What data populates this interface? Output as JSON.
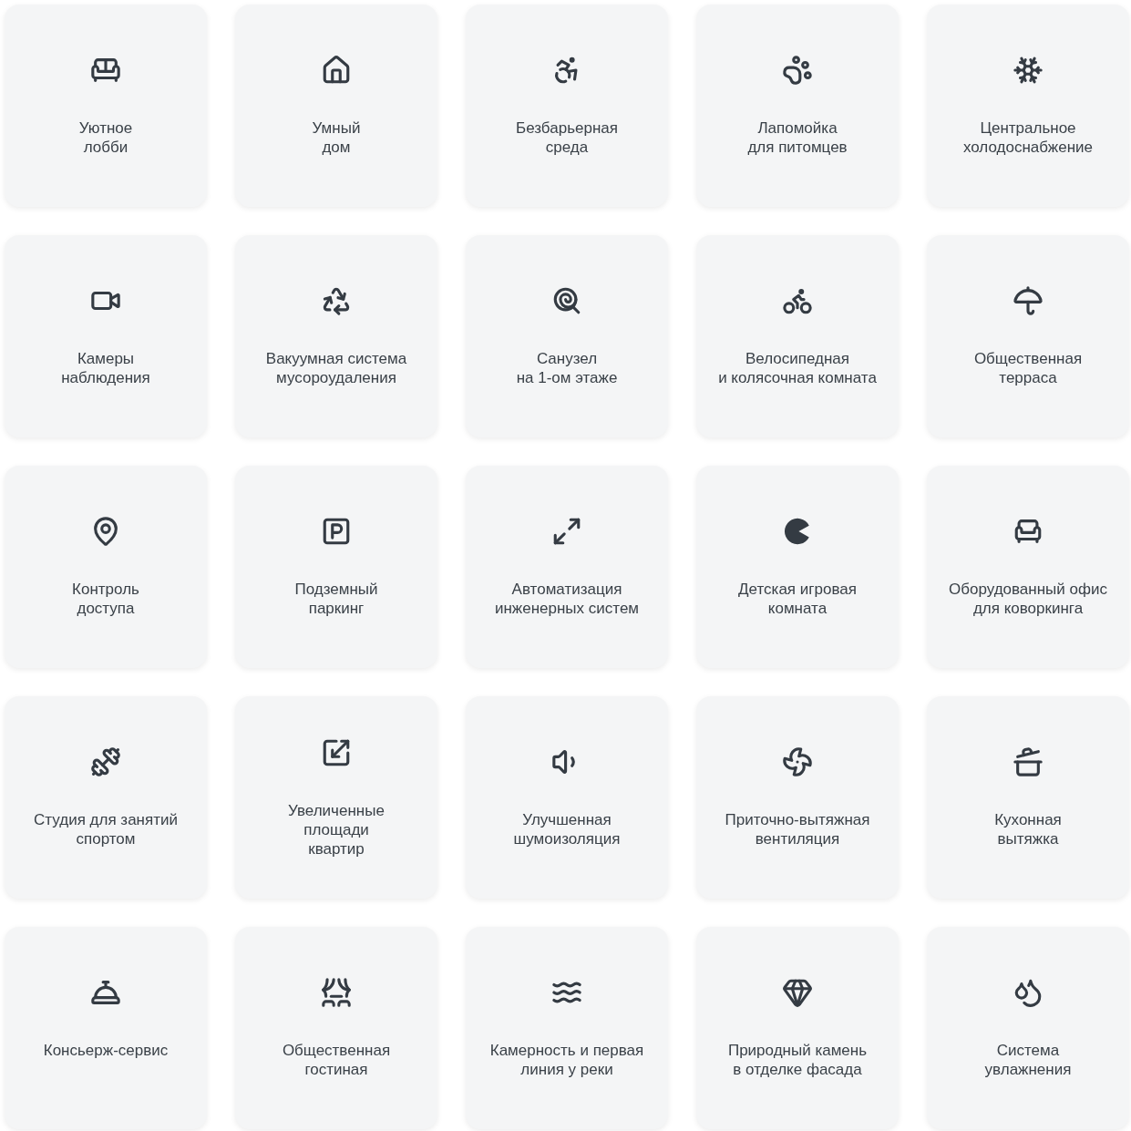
{
  "features": [
    {
      "label": "Уютное\nлобби"
    },
    {
      "label": "Умный\nдом"
    },
    {
      "label": "Безбарьерная\nсреда"
    },
    {
      "label": "Лапомойка\nдля питомцев"
    },
    {
      "label": "Центральное\nхолодоснабжение"
    },
    {
      "label": "Камеры\nнаблюдения"
    },
    {
      "label": "Вакуумная система\nмусороудаления"
    },
    {
      "label": "Санузел\nна 1-ом этаже"
    },
    {
      "label": "Велосипедная\nи колясочная комната"
    },
    {
      "label": "Общественная\nтерраса"
    },
    {
      "label": "Контроль\nдоступа"
    },
    {
      "label": "Подземный\nпаркинг"
    },
    {
      "label": "Автоматизация\nинженерных систем"
    },
    {
      "label": "Детская игровая\nкомната"
    },
    {
      "label": "Оборудованный офис\nдля коворкинга"
    },
    {
      "label": "Студия для занятий\nспортом"
    },
    {
      "label": "Увеличенные\nплощади\nквартир"
    },
    {
      "label": "Улучшенная\nшумоизоляция"
    },
    {
      "label": "Приточно-вытяжная\nвентиляция"
    },
    {
      "label": "Кухонная\nвытяжка"
    },
    {
      "label": "Консьерж-сервис"
    },
    {
      "label": "Общественная\nгостиная"
    },
    {
      "label": "Камерность и первая\nлиния у реки"
    },
    {
      "label": "Природный камень\nв отделке фасада"
    },
    {
      "label": "Система\nувлажнения"
    }
  ]
}
